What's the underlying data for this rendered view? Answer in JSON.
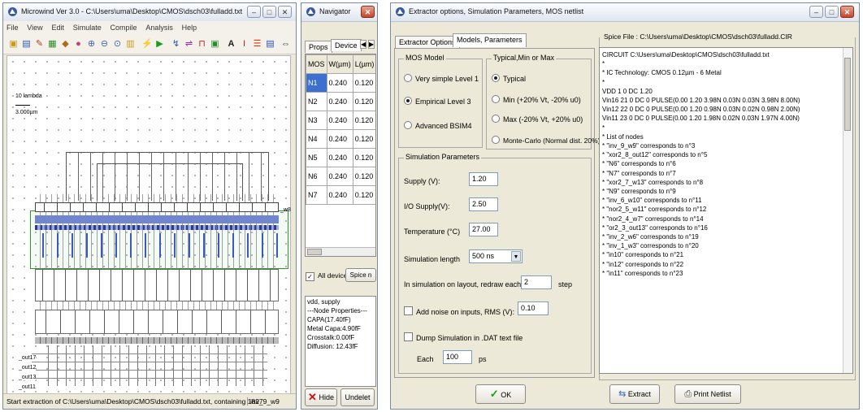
{
  "microwind": {
    "title": "Microwind Ver 3.0 - C:\\Users\\uma\\Desktop\\CMOS\\dsch03\\fulladd.txt",
    "menu": [
      "File",
      "View",
      "Edit",
      "Simulate",
      "Compile",
      "Analysis",
      "Help"
    ],
    "ruler_label": "10 lambda",
    "scale_label": "3.000µm",
    "node_label": "_w8",
    "status": "Start extraction of C:\\Users\\uma\\Desktop\\CMOS\\dsch03\\fulladd.txt, containing 1827",
    "status_right": "inv_9_w9",
    "bottom_labels": [
      "_out17",
      "_out12",
      "_out13",
      "_out11"
    ]
  },
  "navigator": {
    "title": "Navigator",
    "tabs": [
      "Props",
      "Device"
    ],
    "table_header": [
      "MOS",
      "W(µm)",
      "L(µm)"
    ],
    "rows": [
      [
        "N1",
        "0.240",
        "0.120"
      ],
      [
        "N2",
        "0.240",
        "0.120"
      ],
      [
        "N3",
        "0.240",
        "0.120"
      ],
      [
        "N4",
        "0.240",
        "0.120"
      ],
      [
        "N5",
        "0.240",
        "0.120"
      ],
      [
        "N6",
        "0.240",
        "0.120"
      ],
      [
        "N7",
        "0.240",
        "0.120"
      ]
    ],
    "checkbox_label": "All devices",
    "spice_button": "Spice n",
    "props_lines": [
      "vdd, supply",
      "---Node Properties---",
      "CAPA(17.40fF)",
      "Metal Capa:4.90fF",
      "Crosstalk:0.00fF",
      "Diffusion: 12.43fF"
    ],
    "hide_label": "Hide",
    "undo_label": "Undelet"
  },
  "extractor": {
    "title": "Extractor options, Simulation Parameters, MOS netlist",
    "tabs": [
      "Extractor Options",
      "Models, Parameters"
    ],
    "mos_model": {
      "title": "MOS Model",
      "options": [
        "Very simple Level 1",
        "Empirical Level 3",
        "Advanced BSIM4"
      ],
      "selected": 1
    },
    "typical": {
      "title": "Typical,Min or Max",
      "options": [
        "Typical",
        "Min (+20% Vt, -20% u0)",
        "Max (-20% Vt, +20% u0)",
        "Monte-Carlo (Normal dist. 20%)"
      ],
      "selected": 0
    },
    "sim_params": {
      "title": "Simulation Parameters",
      "supply_label": "Supply (V):",
      "supply_value": "1.20",
      "io_label": "I/O Supply(V):",
      "io_value": "2.50",
      "temp_label": "Temperature (°C)",
      "temp_value": "27.00",
      "length_label": "Simulation length",
      "length_value": "500 ns",
      "redraw_label": "In simulation on layout, redraw each",
      "redraw_value": "2",
      "redraw_unit": "step",
      "noise_label": "Add noise on inputs, RMS (V):",
      "noise_value": "0.10",
      "dump_label": "Dump Simulation in .DAT text file",
      "each_label": "Each",
      "each_value": "100",
      "each_unit": "ps"
    },
    "spice_file_label": "Spice File : C:\\Users\\uma\\Desktop\\CMOS\\dsch03\\fulladd.CIR",
    "spice_lines": [
      "CIRCUIT C:\\Users\\uma\\Desktop\\CMOS\\dsch03\\fulladd.txt",
      "*",
      "* IC Technology: CMOS 0.12µm - 6 Metal",
      "*",
      "VDD 1 0 DC 1.20",
      "Vin16 21 0 DC 0 PULSE(0.00 1.20 3.98N 0.03N 0.03N 3.98N 8.00N)",
      "Vin12 22 0 DC 0 PULSE(0.00 1.20 0.98N 0.03N 0.02N 0.98N 2.00N)",
      "Vin11 23 0 DC 0 PULSE(0.00 1.20 1.98N 0.02N 0.03N 1.97N 4.00N)",
      "*",
      "* List of nodes",
      "* \"inv_9_w9\" corresponds to n°3",
      "* \"xor2_8_out12\" corresponds to n°5",
      "* \"N6\" corresponds to n°6",
      "* \"N7\" corresponds to n°7",
      "* \"xor2_7_w13\" corresponds to n°8",
      "* \"N9\" corresponds to n°9",
      "* \"inv_6_w10\" corresponds to n°11",
      "* \"nor2_5_w11\" corresponds to n°12",
      "* \"nor2_4_w7\" corresponds to n°14",
      "* \"or2_3_out13\" corresponds to n°16",
      "* \"inv_2_w6\" corresponds to n°19",
      "* \"inv_1_w3\" corresponds to n°20",
      "* \"in10\" corresponds to n°21",
      "* \"in12\" corresponds to n°22",
      "* \"in11\" corresponds to n°23"
    ],
    "ok_label": "OK",
    "extract_label": "Extract",
    "print_label": "Print Netlist"
  }
}
